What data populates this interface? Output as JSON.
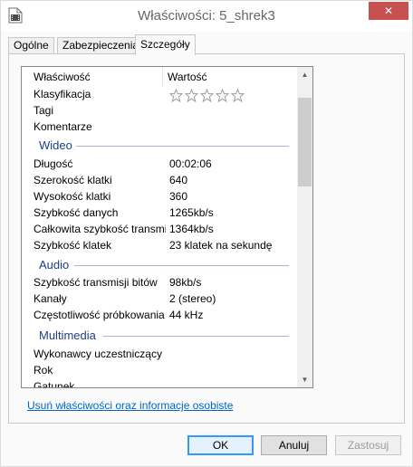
{
  "window": {
    "title": "Właściwości: 5_shrek3",
    "close_glyph": "✕",
    "close_color": "#c75050"
  },
  "tabs": [
    {
      "label": "Ogólne"
    },
    {
      "label": "Zabezpieczenia"
    },
    {
      "label": "Szczegóły",
      "active": true
    }
  ],
  "list": {
    "header_name": "Właściwość",
    "header_value": "Wartość",
    "rows_top": [
      {
        "name": "Klasyfikacja",
        "rating": 0,
        "max": 5
      },
      {
        "name": "Tagi",
        "value": ""
      },
      {
        "name": "Komentarze",
        "value": ""
      }
    ],
    "video_group": "Wideo",
    "video_rows": [
      {
        "name": "Długość",
        "value": "00:02:06"
      },
      {
        "name": "Szerokość klatki",
        "value": "640"
      },
      {
        "name": "Wysokość klatki",
        "value": "360"
      },
      {
        "name": "Szybkość danych",
        "value": "1265kb/s"
      },
      {
        "name": "Całkowita szybkość transmi...",
        "value": "1364kb/s"
      },
      {
        "name": "Szybkość klatek",
        "value": "23 klatek na sekundę"
      }
    ],
    "audio_group": "Audio",
    "audio_rows": [
      {
        "name": "Szybkość transmisji bitów",
        "value": "98kb/s"
      },
      {
        "name": "Kanały",
        "value": "2 (stereo)"
      },
      {
        "name": "Częstotliwość próbkowania ...",
        "value": "44 kHz"
      }
    ],
    "multimedia_group": "Multimedia",
    "multimedia_rows": [
      {
        "name": "Wykonawcy uczestniczący",
        "value": ""
      },
      {
        "name": "Rok",
        "value": ""
      },
      {
        "name": "Gatunek",
        "value": ""
      }
    ],
    "scroll_up": "▲",
    "scroll_down": "▼"
  },
  "remove_link": "Usuń właściwości oraz informacje osobiste",
  "buttons": {
    "ok": "OK",
    "cancel": "Anuluj",
    "apply": "Zastosuj"
  },
  "colors": {
    "group_header": "#1e3f86",
    "link": "#0066cc"
  }
}
